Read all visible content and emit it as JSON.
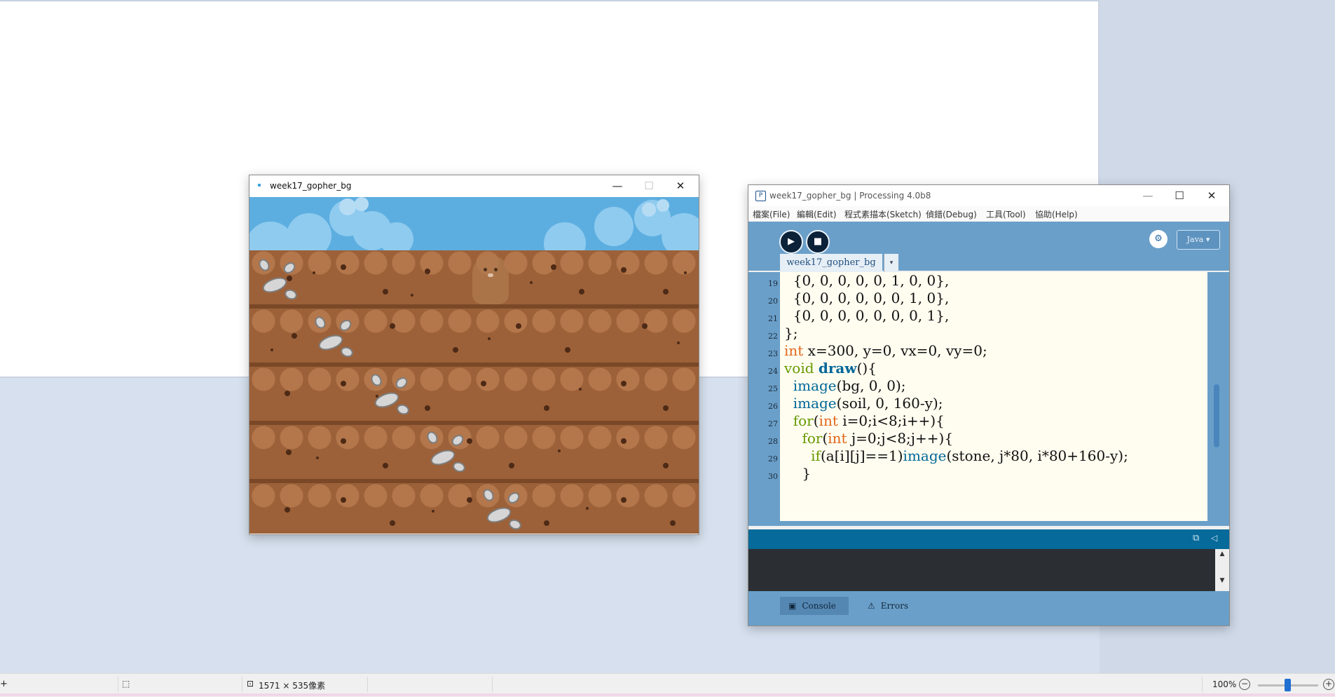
{
  "sketch_window": {
    "title": "week17_gopher_bg",
    "controls": {
      "minimize": "—",
      "maximize": "☐",
      "close": "✕"
    }
  },
  "ide": {
    "title": "week17_gopher_bg | Processing 4.0b8",
    "controls": {
      "minimize": "—",
      "maximize": "☐",
      "close": "✕"
    },
    "menu": [
      "檔案(File)",
      "編輯(Edit)",
      "程式素描本(Sketch)",
      "偵錯(Debug)",
      "工具(Tool)",
      "協助(Help)"
    ],
    "mode": "Java ▾",
    "tab_label": "week17_gopher_bg",
    "tab_arrow": "▾",
    "line_numbers": [
      "19",
      "20",
      "21",
      "22",
      "23",
      "24",
      "25",
      "26",
      "27",
      "28",
      "29",
      "30"
    ],
    "console_tab": "Console",
    "errors_tab": "Errors"
  },
  "statusbar": {
    "size_text": "1571 × 535像素",
    "zoom": "100%"
  },
  "colors": {
    "sky": "#5daee0",
    "soil": "#9c6139",
    "ide_toolbar": "#6a9fc9",
    "ide_status": "#066a9a"
  }
}
